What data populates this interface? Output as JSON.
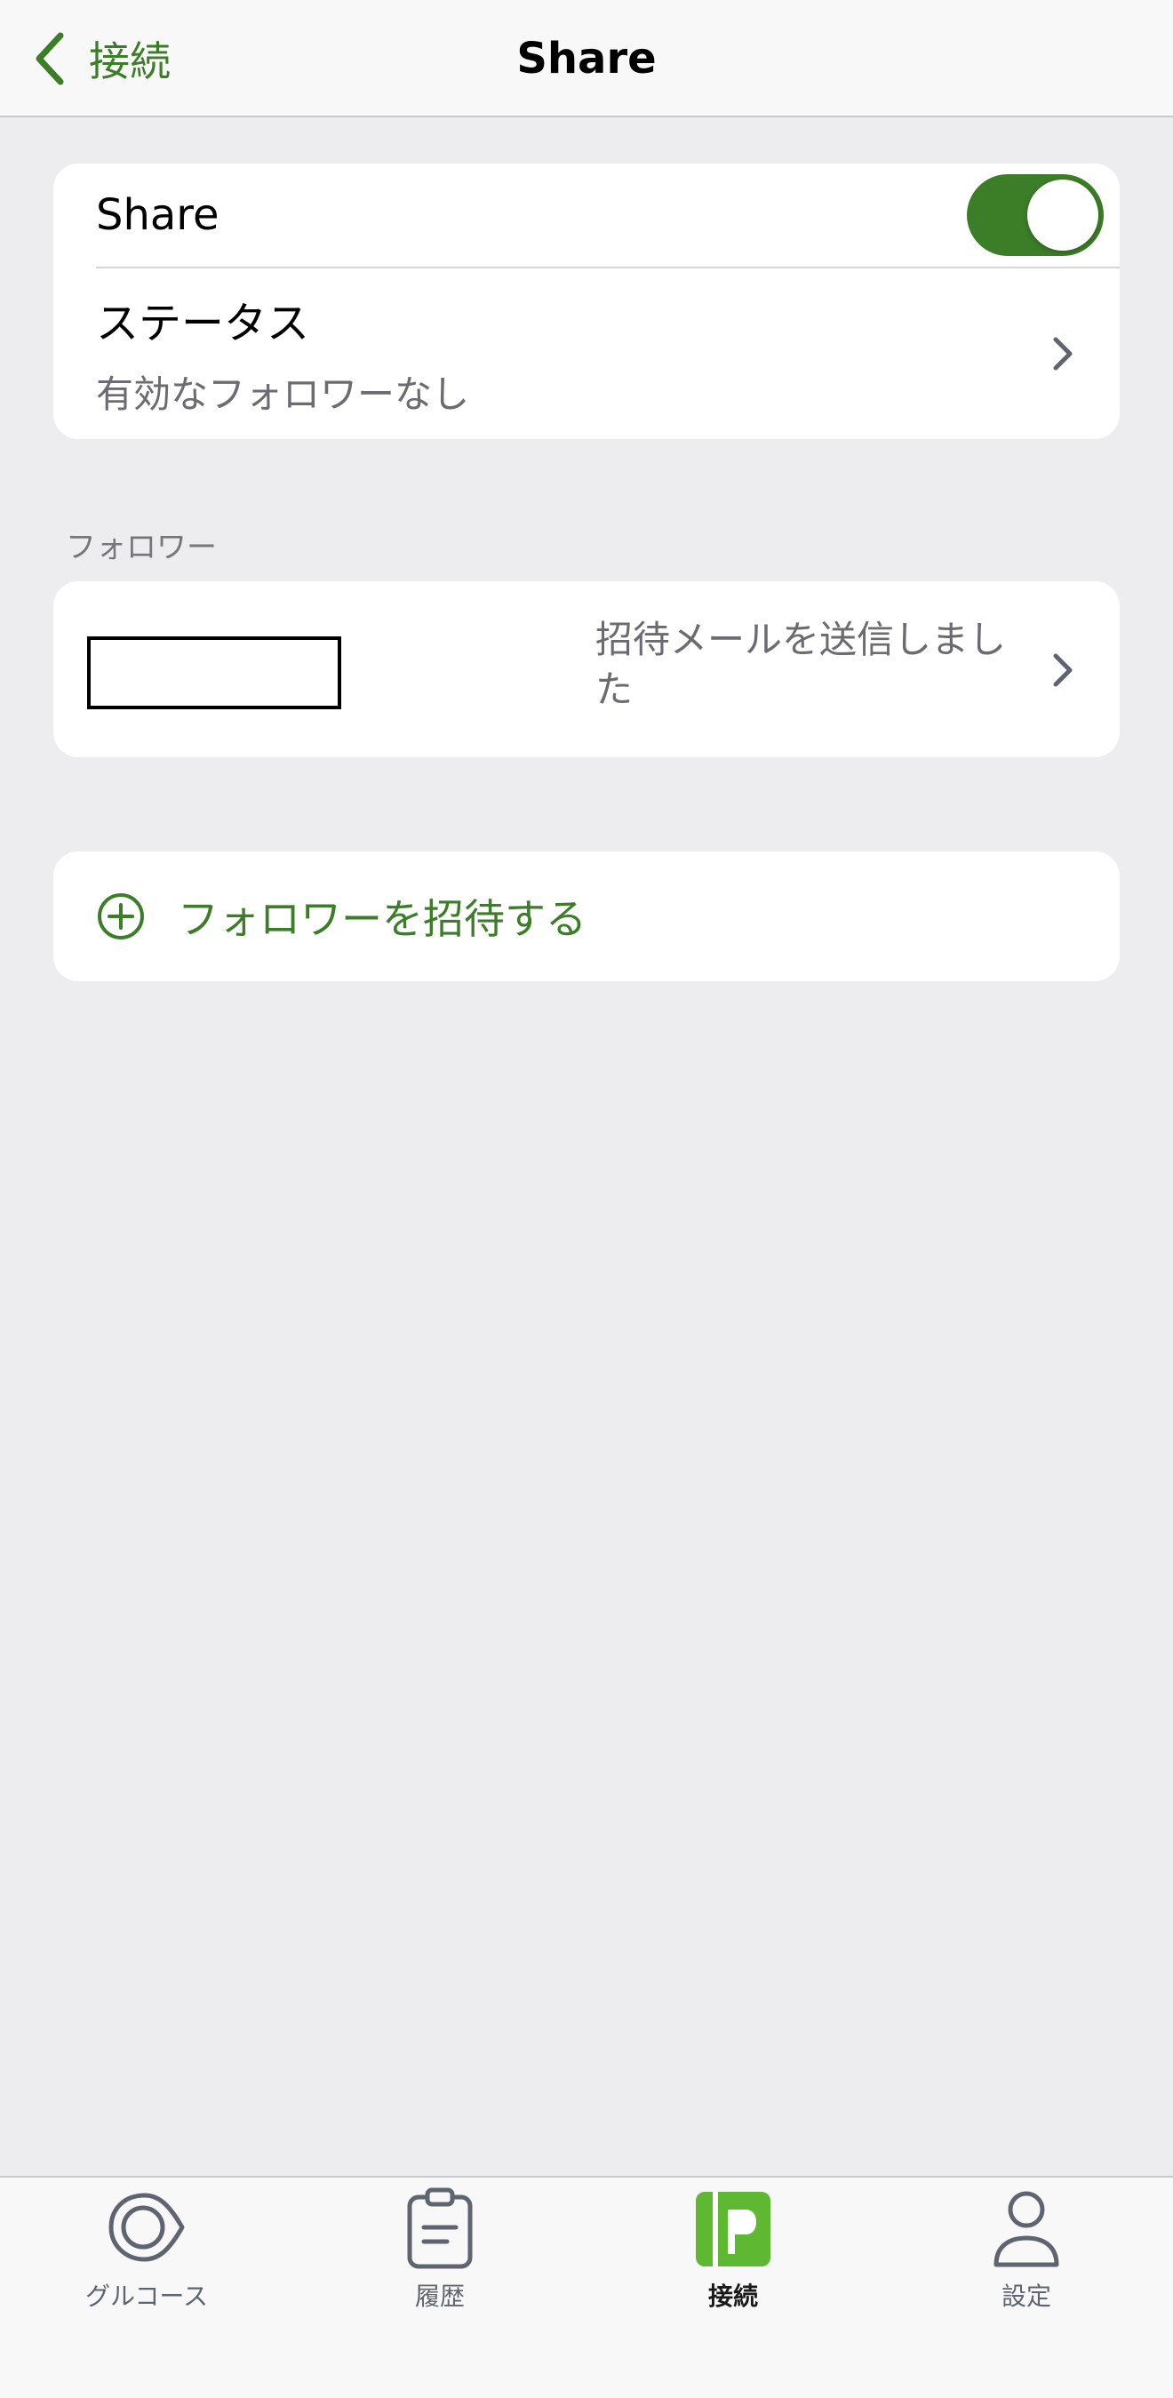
{
  "nav": {
    "back_label": "接続",
    "title": "Share"
  },
  "share_section": {
    "toggle_label": "Share",
    "toggle_on": true,
    "status_title": "ステータス",
    "status_value": "有効なフォロワーなし"
  },
  "followers_section": {
    "header": "フォロワー",
    "rows": [
      {
        "status": "招待メールを送信しました"
      }
    ]
  },
  "invite": {
    "label": "フォロワーを招待する"
  },
  "tabbar": {
    "tabs": [
      {
        "label": "グルコース",
        "icon": "glucose-drop-icon"
      },
      {
        "label": "履歴",
        "icon": "clipboard-icon"
      },
      {
        "label": "接続",
        "icon": "connections-icon",
        "active": true
      },
      {
        "label": "設定",
        "icon": "person-icon"
      }
    ]
  },
  "colors": {
    "accent": "#3c7d28",
    "connections_tab": "#5fb832",
    "background": "#edecee",
    "secondary_text": "#6b6b72"
  }
}
